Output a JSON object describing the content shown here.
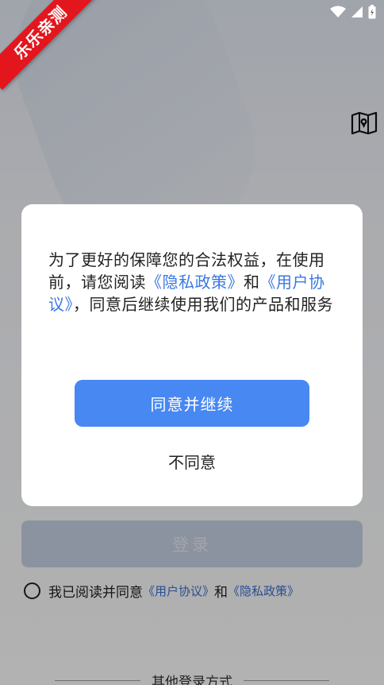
{
  "ribbon": {
    "text": "乐乐亲测"
  },
  "login": {
    "button_label": "登录",
    "agree_prefix": "我已阅读并同意",
    "user_agreement_link": "《用户协议》",
    "and_text": "和",
    "privacy_link": "《隐私政策》",
    "other_login_label": "其他登录方式"
  },
  "dialog": {
    "message_part1": "为了更好的保障您的合法权益，在使用前，请您阅读",
    "privacy_link": "《隐私政策》",
    "and_text": "和",
    "user_agreement_link": "《用户协议》",
    "message_part2": "，同意后继续使用我们的产品和服务",
    "agree_button": "同意并继续",
    "disagree_button": "不同意"
  },
  "colors": {
    "primary": "#4788f3",
    "link": "#3a78e0",
    "ribbon": "#e3161e"
  },
  "icons": {
    "wifi": "wifi-icon",
    "signal": "signal-icon",
    "battery": "battery-icon",
    "map": "map-icon"
  }
}
